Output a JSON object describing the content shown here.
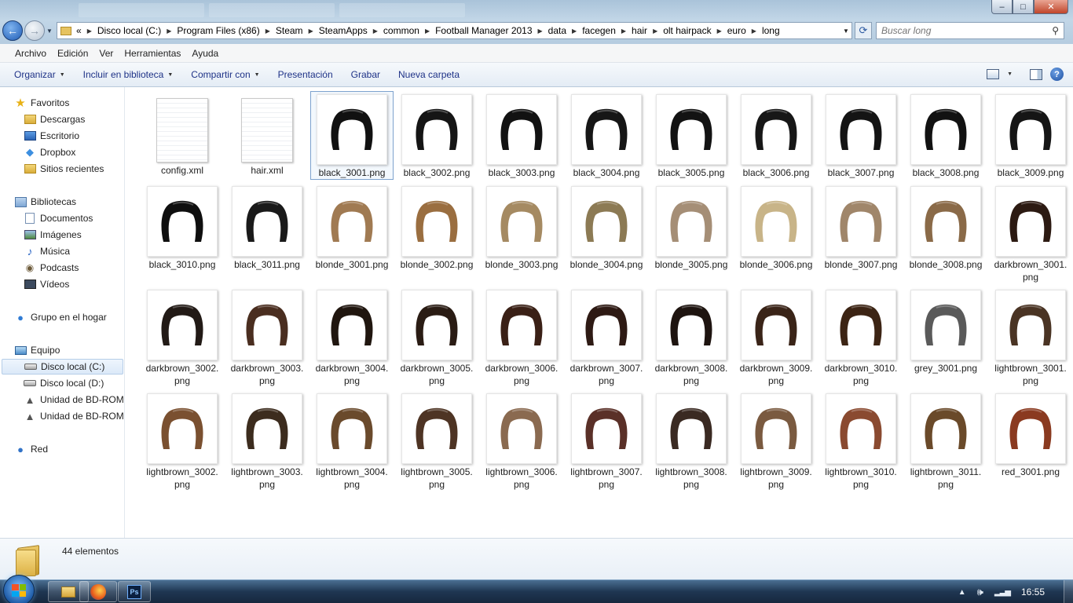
{
  "window": {
    "minimize_label": "–",
    "maximize_label": "□",
    "close_label": "✕"
  },
  "navigation": {
    "back_glyph": "←",
    "forward_glyph": "→",
    "breadcrumb_overflow": "«",
    "breadcrumbs": [
      "Disco local (C:)",
      "Program Files (x86)",
      "Steam",
      "SteamApps",
      "common",
      "Football Manager 2013",
      "data",
      "facegen",
      "hair",
      "olt hairpack",
      "euro",
      "long"
    ],
    "search_placeholder": "Buscar long"
  },
  "menu": [
    "Archivo",
    "Edición",
    "Ver",
    "Herramientas",
    "Ayuda"
  ],
  "commands": {
    "organize": "Organizar",
    "include_library": "Incluir en biblioteca",
    "share_with": "Compartir con",
    "presentation": "Presentación",
    "burn": "Grabar",
    "new_folder": "Nueva carpeta"
  },
  "sidebar": {
    "favorites": {
      "title": "Favoritos",
      "items": [
        "Descargas",
        "Escritorio",
        "Dropbox",
        "Sitios recientes"
      ]
    },
    "libraries": {
      "title": "Bibliotecas",
      "items": [
        "Documentos",
        "Imágenes",
        "Música",
        "Podcasts",
        "Vídeos"
      ]
    },
    "homegroup": "Grupo en el hogar",
    "computer": {
      "title": "Equipo",
      "items": [
        "Disco local (C:)",
        "Disco local (D:)",
        "Unidad de BD-ROM",
        "Unidad de BD-ROM"
      ]
    },
    "network": "Red"
  },
  "files": [
    {
      "name": "config.xml",
      "kind": "doc"
    },
    {
      "name": "hair.xml",
      "kind": "doc"
    },
    {
      "name": "black_3001.png",
      "color": "#111111",
      "selected": true
    },
    {
      "name": "black_3002.png",
      "color": "#151515"
    },
    {
      "name": "black_3003.png",
      "color": "#121212"
    },
    {
      "name": "black_3004.png",
      "color": "#161616"
    },
    {
      "name": "black_3005.png",
      "color": "#131313"
    },
    {
      "name": "black_3006.png",
      "color": "#171717"
    },
    {
      "name": "black_3007.png",
      "color": "#141414"
    },
    {
      "name": "black_3008.png",
      "color": "#121212"
    },
    {
      "name": "black_3009.png",
      "color": "#151515"
    },
    {
      "name": "black_3010.png",
      "color": "#0f0f0f"
    },
    {
      "name": "black_3011.png",
      "color": "#1a1a1a"
    },
    {
      "name": "blonde_3001.png",
      "color": "#a07a52"
    },
    {
      "name": "blonde_3002.png",
      "color": "#9a6e40"
    },
    {
      "name": "blonde_3003.png",
      "color": "#a58a62"
    },
    {
      "name": "blonde_3004.png",
      "color": "#8c7a54"
    },
    {
      "name": "blonde_3005.png",
      "color": "#a58e76"
    },
    {
      "name": "blonde_3006.png",
      "color": "#c8b488"
    },
    {
      "name": "blonde_3007.png",
      "color": "#a0866a"
    },
    {
      "name": "blonde_3008.png",
      "color": "#8a6a48"
    },
    {
      "name": "darkbrown_3001.png",
      "color": "#2c1a12"
    },
    {
      "name": "darkbrown_3002.png",
      "color": "#221a16"
    },
    {
      "name": "darkbrown_3003.png",
      "color": "#4a2e20"
    },
    {
      "name": "darkbrown_3004.png",
      "color": "#20160f"
    },
    {
      "name": "darkbrown_3005.png",
      "color": "#2a1c14"
    },
    {
      "name": "darkbrown_3006.png",
      "color": "#3a2016"
    },
    {
      "name": "darkbrown_3007.png",
      "color": "#2e1a14"
    },
    {
      "name": "darkbrown_3008.png",
      "color": "#1e1410"
    },
    {
      "name": "darkbrown_3009.png",
      "color": "#3a2418"
    },
    {
      "name": "darkbrown_3010.png",
      "color": "#3c2414"
    },
    {
      "name": "grey_3001.png",
      "color": "#5a5a5a"
    },
    {
      "name": "lightbrown_3001.png",
      "color": "#4a3424"
    },
    {
      "name": "lightbrown_3002.png",
      "color": "#7a5030"
    },
    {
      "name": "lightbrown_3003.png",
      "color": "#3c2c1e"
    },
    {
      "name": "lightbrown_3004.png",
      "color": "#6a4a2c"
    },
    {
      "name": "lightbrown_3005.png",
      "color": "#4e3424"
    },
    {
      "name": "lightbrown_3006.png",
      "color": "#8a6a50"
    },
    {
      "name": "lightbrown_3007.png",
      "color": "#5a3028"
    },
    {
      "name": "lightbrown_3008.png",
      "color": "#3a2a22"
    },
    {
      "name": "lightbrown_3009.png",
      "color": "#7a5a40"
    },
    {
      "name": "lightbrown_3010.png",
      "color": "#8a4a30"
    },
    {
      "name": "lightbrown_3011.png",
      "color": "#6a4a2a"
    },
    {
      "name": "red_3001.png",
      "color": "#8a3a20"
    }
  ],
  "status": {
    "item_count": "44 elementos"
  },
  "taskbar": {
    "photoshop_label": "Ps",
    "clock": "16:55"
  }
}
